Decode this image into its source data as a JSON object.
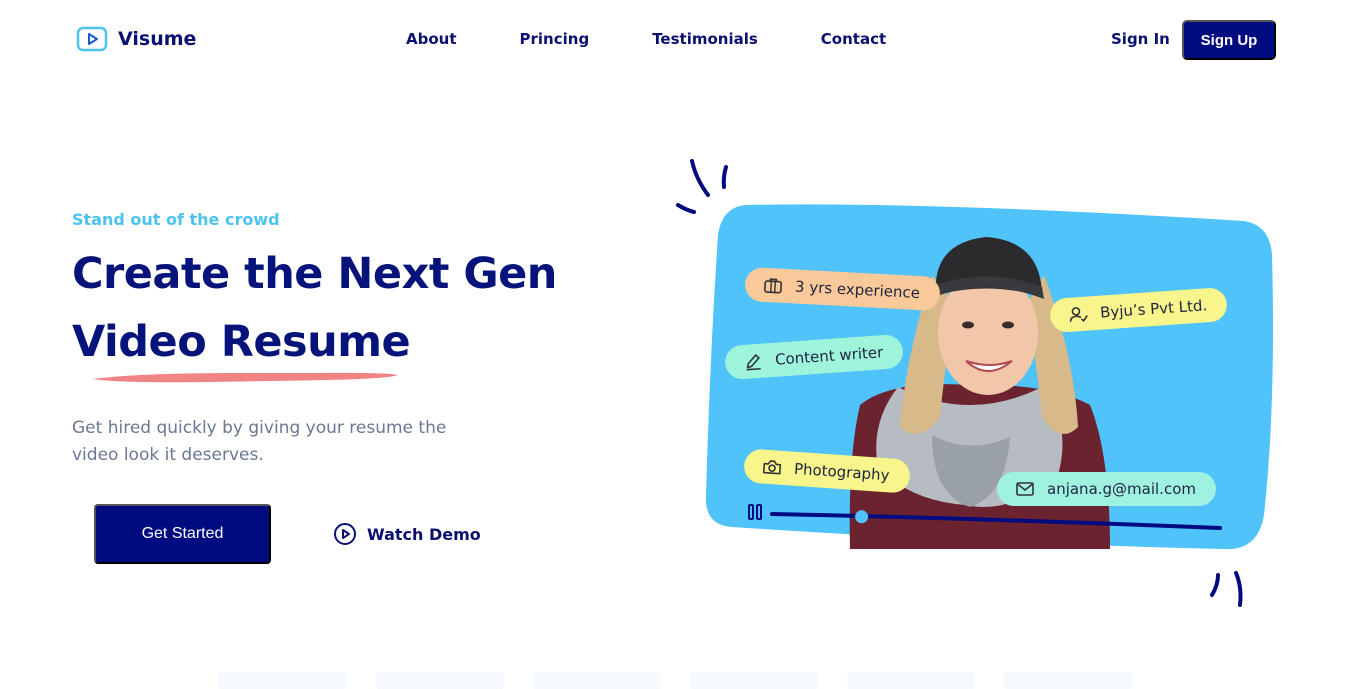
{
  "brand": {
    "name": "Visume",
    "icon": "play-square-icon",
    "color": "#010b80",
    "accent": "#4fc3ef"
  },
  "nav": {
    "links": [
      "About",
      "Princing",
      "Testimonials",
      "Contact"
    ],
    "signin": "Sign In",
    "signup": "Sign Up"
  },
  "hero": {
    "tagline": "Stand out of the crowd",
    "headline_line1": "Create the Next Gen",
    "headline_line2": "Video Resume",
    "subtext": "Get hired quickly by giving your resume the video look it deserves.",
    "cta_primary": "Get Started",
    "cta_secondary": "Watch Demo"
  },
  "profile_chips": {
    "experience": {
      "text": "3 yrs experience",
      "icon": "briefcase-icon"
    },
    "company": {
      "text": "Byju’s Pvt Ltd.",
      "icon": "user-check-icon"
    },
    "role": {
      "text": "Content writer",
      "icon": "pen-icon"
    },
    "hobby": {
      "text": "Photography",
      "icon": "camera-icon"
    },
    "email": {
      "text": "anjana.g@mail.com",
      "icon": "mail-icon"
    }
  },
  "video_player": {
    "progress": 0.2,
    "pause_icon": "pause-icon"
  }
}
